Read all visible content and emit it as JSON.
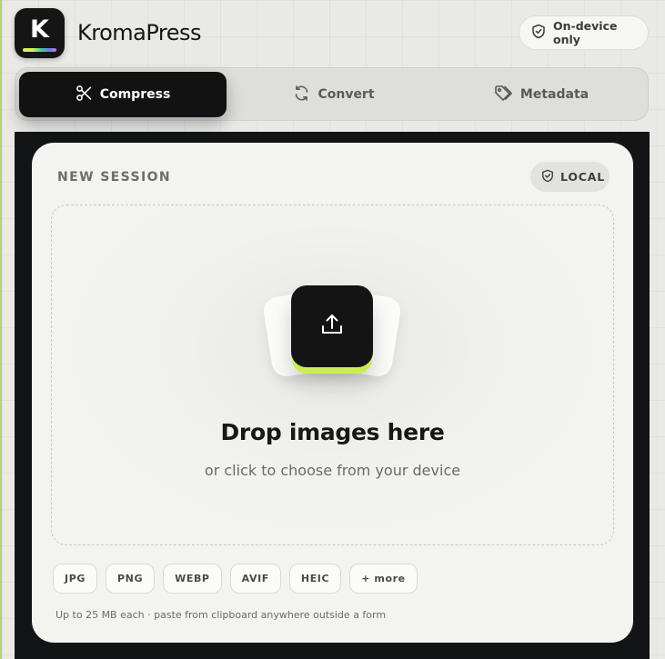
{
  "app": {
    "logo_letter": "K",
    "name": "KromaPress",
    "privacy_label": "On-device only"
  },
  "tabs": [
    {
      "label": "Compress",
      "icon": "scissors-icon",
      "active": true
    },
    {
      "label": "Convert",
      "icon": "refresh-icon",
      "active": false
    },
    {
      "label": "Metadata",
      "icon": "tag-icon",
      "active": false
    }
  ],
  "session": {
    "label": "NEW SESSION",
    "badge": "LOCAL"
  },
  "dropzone": {
    "icon": "upload-icon",
    "title": "Drop images here",
    "subtitle": "or click to choose from your device"
  },
  "formats": [
    "JPG",
    "PNG",
    "WEBP",
    "AVIF",
    "HEIC",
    "+ more"
  ],
  "footnote": "Up to 25 MB each · paste from clipboard anywhere outside a form",
  "colors": {
    "accent": "#c9ee55",
    "dark": "#121212",
    "card": "#f3f3ef"
  }
}
